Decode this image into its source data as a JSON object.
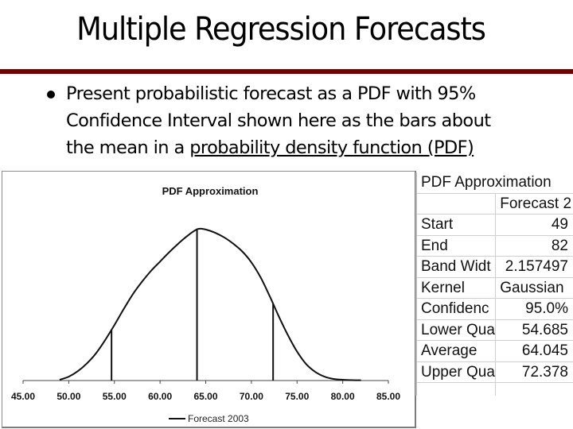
{
  "slide": {
    "title": "Multiple Regression Forecasts",
    "accent_color": "#7a0000",
    "bullet": {
      "icon": "bullet-dot",
      "lines": [
        "Present probabilistic forecast as a PDF with 95%",
        "Confidence Interval shown here as the bars about",
        "the mean in a "
      ],
      "underlined_text": "probability density function (PDF)"
    }
  },
  "chart_data": {
    "type": "line",
    "title": "PDF Approximation",
    "xlabel": "",
    "ylabel": "",
    "xlim": [
      45,
      85
    ],
    "x_ticks": [
      "45.00",
      "50.00",
      "55.00",
      "60.00",
      "65.00",
      "70.00",
      "75.00",
      "80.00",
      "85.00"
    ],
    "x_tick_values": [
      45,
      50,
      55,
      60,
      65,
      70,
      75,
      80,
      85
    ],
    "y_axis_visible": false,
    "grid": false,
    "legend": {
      "position": "bottom",
      "entries": [
        "Forecast 2003"
      ]
    },
    "series": [
      {
        "name": "Forecast 2003",
        "x": [
          49,
          50,
          51,
          52,
          53,
          54,
          55,
          56,
          57,
          58,
          59,
          60,
          61,
          62,
          63,
          64,
          64.5,
          65,
          66,
          67,
          68,
          69,
          70,
          71,
          72,
          73,
          74,
          75,
          76,
          77,
          78,
          79,
          80,
          81,
          82
        ],
        "y": [
          0.001,
          0.005,
          0.012,
          0.022,
          0.035,
          0.052,
          0.071,
          0.091,
          0.11,
          0.126,
          0.14,
          0.152,
          0.164,
          0.175,
          0.185,
          0.193,
          0.194,
          0.193,
          0.189,
          0.183,
          0.175,
          0.165,
          0.151,
          0.132,
          0.108,
          0.082,
          0.058,
          0.037,
          0.021,
          0.011,
          0.005,
          0.002,
          0.001,
          0.0005,
          0.0004
        ]
      }
    ],
    "ylim": [
      0,
      0.2
    ],
    "interval_bars": [
      {
        "name": "Lower Quantile",
        "x": 54.685,
        "y": 0.065
      },
      {
        "name": "Average",
        "x": 64.045,
        "y": 0.194
      },
      {
        "name": "Upper Quantile",
        "x": 72.378,
        "y": 0.098
      }
    ]
  },
  "sheet": {
    "title": "PDF Approximation",
    "column_header": "Forecast 2",
    "rows": [
      {
        "label": "Start",
        "value": "49",
        "align": "num"
      },
      {
        "label": "End",
        "value": "82",
        "align": "num"
      },
      {
        "label": "Band Widt",
        "value": "2.157497",
        "align": "num"
      },
      {
        "label": "Kernel",
        "value": "Gaussian",
        "align": "txt"
      },
      {
        "label": "Confidenc",
        "value": "95.0%",
        "align": "num"
      },
      {
        "label": "Lower Qua",
        "value": "54.685",
        "align": "num"
      },
      {
        "label": "Average",
        "value": "64.045",
        "align": "num"
      },
      {
        "label": "Upper Qua",
        "value": "72.378",
        "align": "num"
      }
    ]
  }
}
